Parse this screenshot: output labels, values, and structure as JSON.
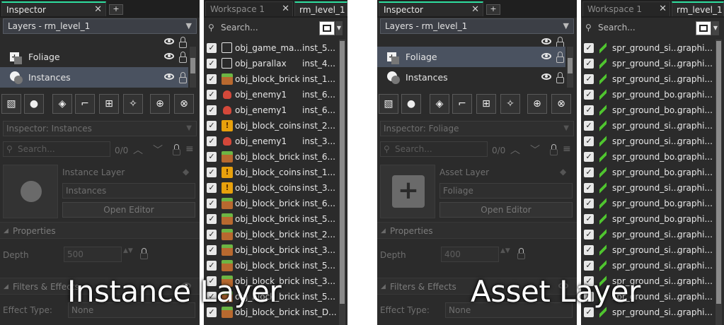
{
  "left": {
    "inspector_tab": "Inspector",
    "workspace_tab": "Workspace 1",
    "room_tab": "rm_level_1",
    "layers_dropdown": "Layers - rm_level_1",
    "layers": [
      "Foliage",
      "Instances"
    ],
    "selected_layer": "Instances",
    "inspector_title": "Inspector: Instances",
    "search_placeholder": "Search...",
    "match_count": "0/0",
    "layer_type": "Instance Layer",
    "layer_name": "Instances",
    "open_editor": "Open Editor",
    "properties": "Properties",
    "depth_label": "Depth",
    "depth_value": "500",
    "filters_label": "Filters & Effects",
    "effect_type_label": "Effect Type:",
    "effect_type_value": "None",
    "list_search_placeholder": "Search...",
    "items": [
      {
        "name": "obj_game_ma...",
        "id": "inst_5...",
        "icon": "blank-sprite-icon"
      },
      {
        "name": "obj_parallax",
        "id": "inst_4...",
        "icon": "blank-sprite-icon"
      },
      {
        "name": "obj_block_brick",
        "id": "inst_1...",
        "icon": "brick-icon"
      },
      {
        "name": "obj_enemy1",
        "id": "inst_6...",
        "icon": "enemy-icon"
      },
      {
        "name": "obj_enemy1",
        "id": "inst_6...",
        "icon": "enemy-icon"
      },
      {
        "name": "obj_block_coins",
        "id": "inst_2...",
        "icon": "coin-block-icon"
      },
      {
        "name": "obj_enemy1",
        "id": "inst_3...",
        "icon": "enemy-icon"
      },
      {
        "name": "obj_block_brick",
        "id": "inst_6...",
        "icon": "brick-icon"
      },
      {
        "name": "obj_block_coins",
        "id": "inst_1...",
        "icon": "coin-block-icon"
      },
      {
        "name": "obj_block_coins",
        "id": "inst_3...",
        "icon": "coin-block-icon"
      },
      {
        "name": "obj_block_brick",
        "id": "inst_6...",
        "icon": "brick-icon"
      },
      {
        "name": "obj_block_brick",
        "id": "inst_5...",
        "icon": "brick-icon"
      },
      {
        "name": "obj_block_brick",
        "id": "inst_2...",
        "icon": "brick-icon"
      },
      {
        "name": "obj_block_brick",
        "id": "inst_3...",
        "icon": "brick-icon"
      },
      {
        "name": "obj_block_brick",
        "id": "inst_5...",
        "icon": "brick-icon"
      },
      {
        "name": "obj_block_brick",
        "id": "inst_3...",
        "icon": "brick-icon"
      },
      {
        "name": "obj_block_brick",
        "id": "inst_5...",
        "icon": "brick-icon"
      },
      {
        "name": "obj_block_brick",
        "id": "inst_D...",
        "icon": "brick-icon"
      }
    ],
    "caption": "Instance Layer"
  },
  "right": {
    "inspector_tab": "Inspector",
    "workspace_tab": "Workspace 1",
    "room_tab": "rm_level_1",
    "layers_dropdown": "Layers - rm_level_1",
    "layers": [
      "Foliage",
      "Instances"
    ],
    "selected_layer": "Foliage",
    "inspector_title": "Inspector: Foliage",
    "search_placeholder": "Search...",
    "match_count": "0/0",
    "layer_type": "Asset Layer",
    "layer_name": "Foliage",
    "open_editor": "Open Editor",
    "properties": "Properties",
    "depth_label": "Depth",
    "depth_value": "400",
    "filters_label": "Filters & Effects",
    "effect_type_label": "Effect Type:",
    "effect_type_value": "None",
    "list_search_placeholder": "Search...",
    "items": [
      {
        "name": "spr_ground_si...",
        "id": "graphi..."
      },
      {
        "name": "spr_ground_si...",
        "id": "graphi..."
      },
      {
        "name": "spr_ground_si...",
        "id": "graphi..."
      },
      {
        "name": "spr_ground_bo...",
        "id": "graphi..."
      },
      {
        "name": "spr_ground_bo...",
        "id": "graphi..."
      },
      {
        "name": "spr_ground_si...",
        "id": "graphi..."
      },
      {
        "name": "spr_ground_si...",
        "id": "graphi..."
      },
      {
        "name": "spr_ground_bo...",
        "id": "graphi..."
      },
      {
        "name": "spr_ground_bo...",
        "id": "graphi..."
      },
      {
        "name": "spr_ground_si...",
        "id": "graphi..."
      },
      {
        "name": "spr_ground_bo...",
        "id": "graphi..."
      },
      {
        "name": "spr_ground_bo...",
        "id": "graphi..."
      },
      {
        "name": "spr_ground_si...",
        "id": "graphi..."
      },
      {
        "name": "spr_ground_si...",
        "id": "graphi..."
      },
      {
        "name": "spr_ground_si...",
        "id": "graphi..."
      },
      {
        "name": "spr_ground_si...",
        "id": "graphi..."
      },
      {
        "name": "spr_ground_si...",
        "id": "graphi..."
      },
      {
        "name": "spr_ground_si...",
        "id": "graphi..."
      }
    ],
    "caption": "Asset Layer"
  },
  "colors": {
    "accent": "#2fe0a0",
    "panel_bg": "#2b2b2b",
    "selection": "#4a5260"
  }
}
